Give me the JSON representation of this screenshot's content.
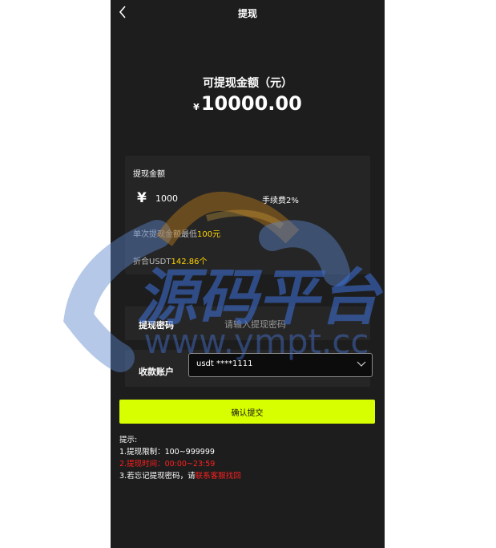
{
  "header": {
    "title": "提现"
  },
  "balance": {
    "label": "可提现金额（元）",
    "currency_symbol": "¥",
    "amount": "10000.00"
  },
  "form": {
    "amount_label": "提现金额",
    "amount_symbol": "¥",
    "amount_value": "1000",
    "fee_label": "手续费2%",
    "min_prefix": "单次提现金额最低",
    "min_value": "100元",
    "usdt_prefix": "折合USDT",
    "usdt_value": "142.86个",
    "password_label": "提现密码",
    "password_placeholder": "请输入提现密码",
    "account_label": "收款账户",
    "account_selected": "usdt ****1111",
    "submit_label": "确认提交"
  },
  "tips": {
    "title": "提示:",
    "limit": "1.提现限制：100~999999",
    "time": "2.提现时间：00:00~23:59",
    "forgot_prefix": "3.若忘记提现密码，请",
    "forgot_link": "联系客服找回"
  },
  "watermark": {
    "title": "源码平台",
    "url": "www.ympt.cc"
  },
  "colors": {
    "accent": "#d8ff00",
    "highlight": "#ffd400",
    "danger": "#ff2020",
    "background": "#1d1d1d"
  }
}
